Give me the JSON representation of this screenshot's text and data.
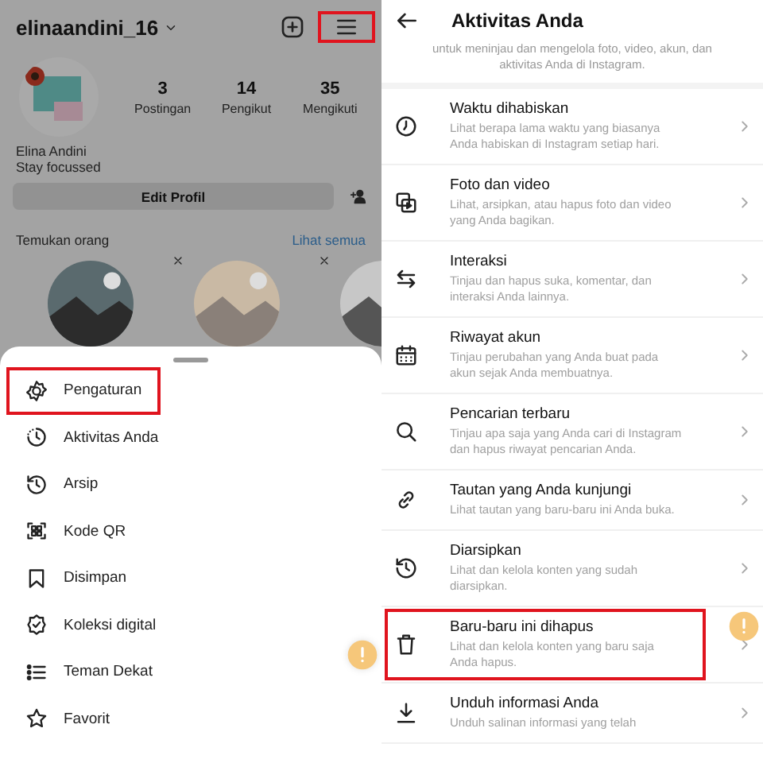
{
  "profile": {
    "username": "elinaandini_16",
    "menu_highlighted": true,
    "stats": [
      {
        "value": "3",
        "label": "Postingan"
      },
      {
        "value": "14",
        "label": "Pengikut"
      },
      {
        "value": "35",
        "label": "Mengikuti"
      }
    ],
    "name": "Elina Andini",
    "bio": "Stay focussed",
    "edit_button": "Edit Profil",
    "discover": {
      "title": "Temukan orang",
      "link": "Lihat semua"
    }
  },
  "menu": [
    {
      "label": "Pengaturan",
      "highlighted": true
    },
    {
      "label": "Aktivitas Anda",
      "highlighted": false
    },
    {
      "label": "Arsip",
      "highlighted": false
    },
    {
      "label": "Kode QR",
      "highlighted": false
    },
    {
      "label": "Disimpan",
      "highlighted": false
    },
    {
      "label": "Koleksi digital",
      "highlighted": false
    },
    {
      "label": "Teman Dekat",
      "highlighted": false
    },
    {
      "label": "Favorit",
      "highlighted": false
    }
  ],
  "activity": {
    "title": "Aktivitas Anda",
    "intro": "untuk meninjau dan mengelola foto, video, akun, dan aktivitas Anda di Instagram.",
    "items": [
      {
        "title": "Waktu dihabiskan",
        "description": "Lihat berapa lama waktu yang biasanya Anda habiskan di Instagram setiap hari.",
        "highlighted": false
      },
      {
        "title": "Foto dan video",
        "description": "Lihat, arsipkan, atau hapus foto dan video yang Anda bagikan.",
        "highlighted": false
      },
      {
        "title": "Interaksi",
        "description": "Tinjau dan hapus suka, komentar, dan interaksi Anda lainnya.",
        "highlighted": false
      },
      {
        "title": "Riwayat akun",
        "description": "Tinjau perubahan yang Anda buat pada akun sejak Anda membuatnya.",
        "highlighted": false
      },
      {
        "title": "Pencarian terbaru",
        "description": "Tinjau apa saja yang Anda cari di Instagram dan hapus riwayat pencarian Anda.",
        "highlighted": false
      },
      {
        "title": "Tautan yang Anda kunjungi",
        "description": "Lihat tautan yang baru-baru ini Anda buka.",
        "highlighted": false
      },
      {
        "title": "Diarsipkan",
        "description": "Lihat dan kelola konten yang sudah diarsipkan.",
        "highlighted": false
      },
      {
        "title": "Baru-baru ini dihapus",
        "description": "Lihat dan kelola konten yang baru saja Anda hapus.",
        "highlighted": true
      },
      {
        "title": "Unduh informasi Anda",
        "description": "Unduh salinan informasi yang telah",
        "highlighted": false
      }
    ]
  }
}
